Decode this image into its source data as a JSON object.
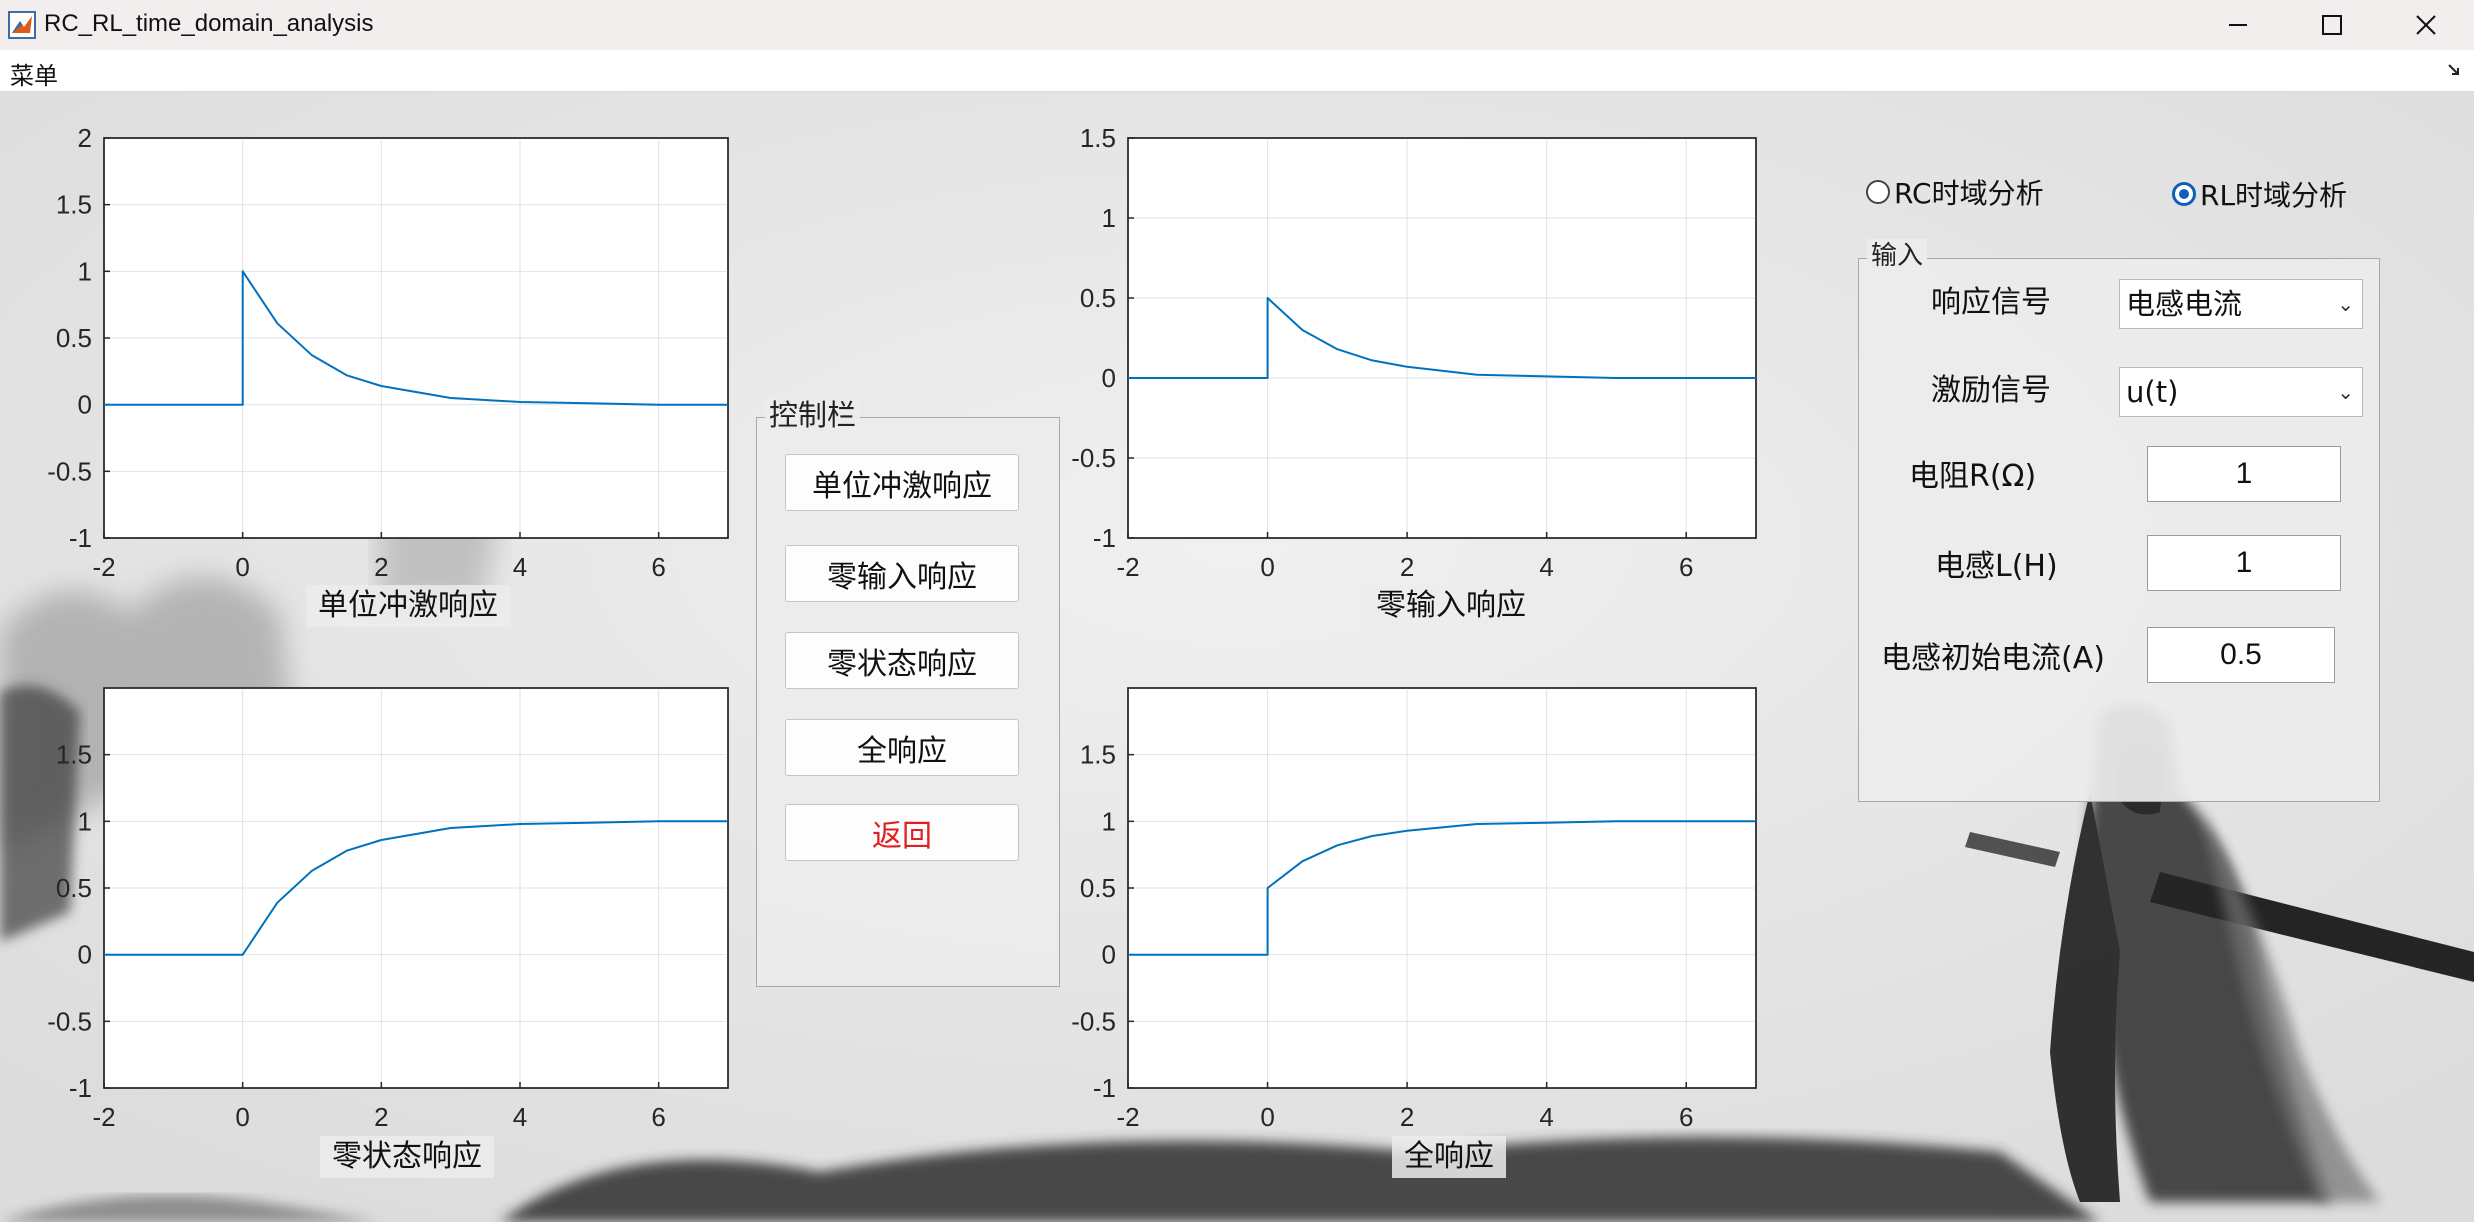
{
  "window": {
    "title": "RC_RL_time_domain_analysis",
    "minimize_icon": "minimize-icon",
    "maximize_icon": "maximize-icon",
    "close_icon": "close-icon"
  },
  "menu": {
    "label": "菜单",
    "toggle_icon": "menu-toggle-icon"
  },
  "plots": [
    {
      "caption": "单位冲激响应",
      "x_ticks": [
        "-2",
        "0",
        "2",
        "4",
        "6"
      ],
      "y_ticks": [
        "2",
        "1.5",
        "1",
        "0.5",
        "0",
        "-0.5",
        "-1"
      ]
    },
    {
      "caption": "零输入响应",
      "x_ticks": [
        "-2",
        "0",
        "2",
        "4",
        "6"
      ],
      "y_ticks": [
        "1.5",
        "1",
        "0.5",
        "0",
        "-0.5",
        "-1"
      ]
    },
    {
      "caption": "零状态响应",
      "x_ticks": [
        "-2",
        "0",
        "2",
        "4",
        "6"
      ],
      "y_ticks": [
        "1.5",
        "1",
        "0.5",
        "0",
        "-0.5",
        "-1"
      ]
    },
    {
      "caption": "全响应",
      "x_ticks": [
        "-2",
        "0",
        "2",
        "4",
        "6"
      ],
      "y_ticks": [
        "1.5",
        "1",
        "0.5",
        "0",
        "-0.5",
        "-1"
      ]
    }
  ],
  "chart_data": [
    {
      "type": "line",
      "xlim": [
        -2,
        7
      ],
      "ylim": [
        -1,
        2
      ],
      "grid": true,
      "line_color": "#0072BD",
      "x": [
        -2,
        0,
        0,
        0.5,
        1,
        1.5,
        2,
        3,
        4,
        5,
        6,
        7
      ],
      "y": [
        0,
        0,
        1,
        0.61,
        0.37,
        0.22,
        0.14,
        0.05,
        0.02,
        0.01,
        0,
        0
      ],
      "xlabel": "单位冲激响应"
    },
    {
      "type": "line",
      "xlim": [
        -2,
        7
      ],
      "ylim": [
        -1,
        1.5
      ],
      "grid": true,
      "line_color": "#0072BD",
      "x": [
        -2,
        0,
        0,
        0.5,
        1,
        1.5,
        2,
        3,
        4,
        5,
        6,
        7
      ],
      "y": [
        0,
        0,
        0.5,
        0.3,
        0.18,
        0.11,
        0.07,
        0.02,
        0.01,
        0,
        0,
        0
      ],
      "xlabel": "零输入响应"
    },
    {
      "type": "line",
      "xlim": [
        -2,
        7
      ],
      "ylim": [
        -1,
        2
      ],
      "grid": true,
      "line_color": "#0072BD",
      "x": [
        -2,
        0,
        0.5,
        1,
        1.5,
        2,
        3,
        4,
        5,
        6,
        7
      ],
      "y": [
        0,
        0,
        0.39,
        0.63,
        0.78,
        0.86,
        0.95,
        0.98,
        0.99,
        1,
        1
      ],
      "xlabel": "零状态响应"
    },
    {
      "type": "line",
      "xlim": [
        -2,
        7
      ],
      "ylim": [
        -1,
        2
      ],
      "grid": true,
      "line_color": "#0072BD",
      "x": [
        -2,
        0,
        0,
        0.5,
        1,
        1.5,
        2,
        3,
        4,
        5,
        6,
        7
      ],
      "y": [
        0,
        0,
        0.5,
        0.7,
        0.82,
        0.89,
        0.93,
        0.98,
        0.99,
        1,
        1,
        1
      ],
      "xlabel": "全响应"
    }
  ],
  "control_panel": {
    "title": "控制栏",
    "buttons": [
      {
        "label": "单位冲激响应",
        "color": "#111111"
      },
      {
        "label": "零输入响应",
        "color": "#111111"
      },
      {
        "label": "零状态响应",
        "color": "#111111"
      },
      {
        "label": "全响应",
        "color": "#111111"
      },
      {
        "label": "返回",
        "color": "#e02020"
      }
    ]
  },
  "analysis_mode": {
    "options": [
      {
        "label": "RC时域分析",
        "selected": false
      },
      {
        "label": "RL时域分析",
        "selected": true
      }
    ]
  },
  "input_panel": {
    "title": "输入",
    "response_signal": {
      "label": "响应信号",
      "value": "电感电流"
    },
    "excitation_signal": {
      "label": "激励信号",
      "value": "u(t)"
    },
    "resistance": {
      "label": "电阻R(Ω)",
      "value": "1"
    },
    "inductance": {
      "label": "电感L(H)",
      "value": "1"
    },
    "initial_current": {
      "label": "电感初始电流(A)",
      "value": "0.5"
    }
  }
}
